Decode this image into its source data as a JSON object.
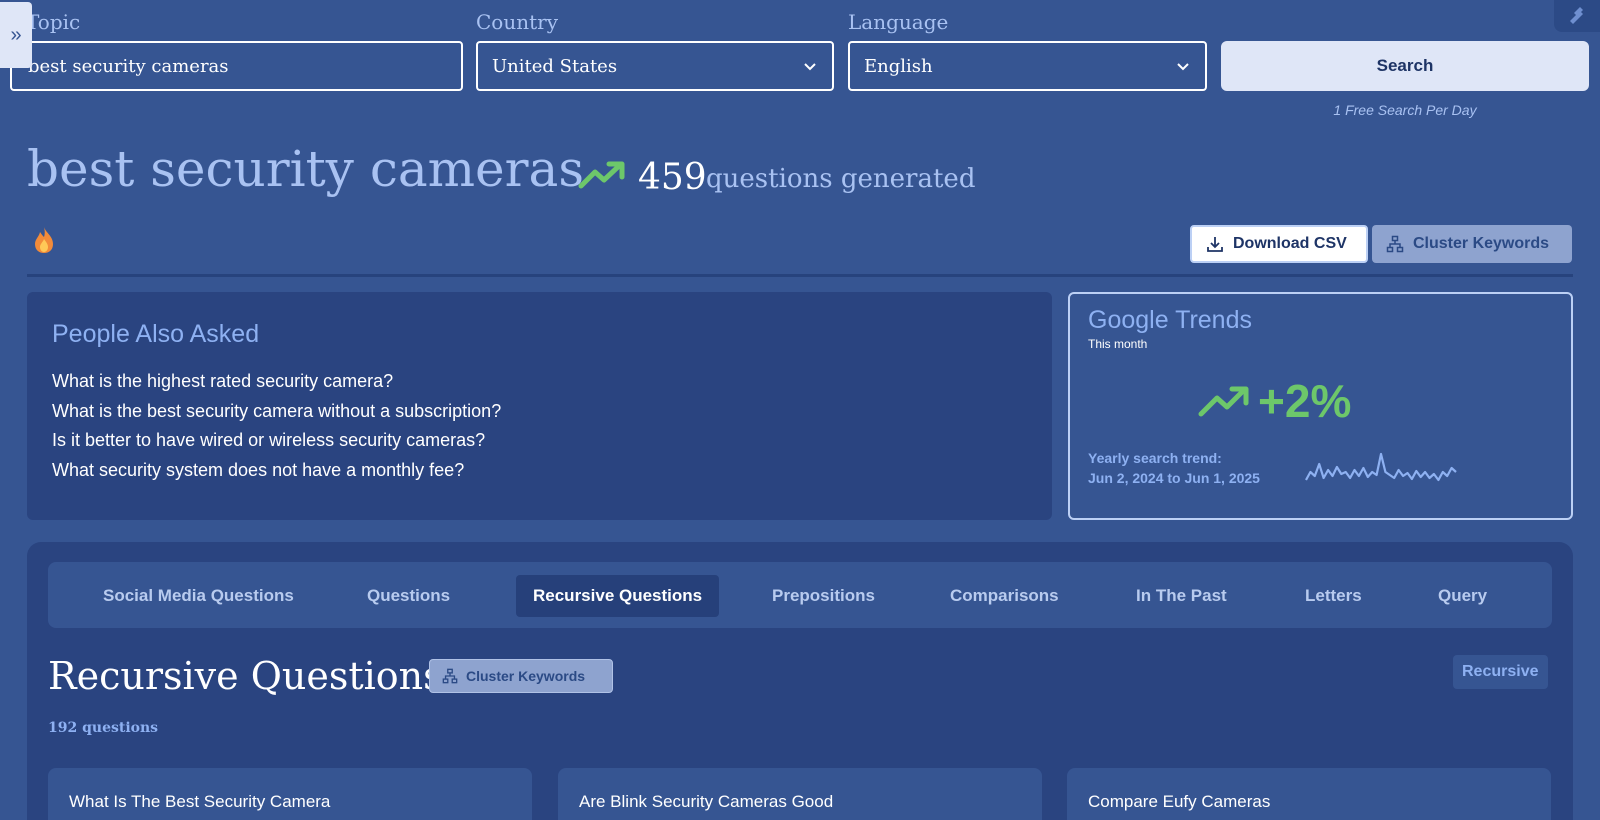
{
  "search_form": {
    "topic_label": "Topic",
    "topic_value": "best security cameras",
    "country_label": "Country",
    "country_value": "United States",
    "language_label": "Language",
    "language_value": "English",
    "search_button": "Search",
    "free_note": "1 Free Search Per Day"
  },
  "header": {
    "title": "best security cameras",
    "question_count": "459",
    "question_label": "questions generated",
    "download_csv": "Download CSV",
    "cluster_keywords": "Cluster Keywords"
  },
  "people_also_asked": {
    "title": "People Also Asked",
    "questions": [
      "What is the highest rated security camera?",
      "What is the best security camera without a subscription?",
      "Is it better to have wired or wireless security cameras?",
      "What security system does not have a monthly fee?"
    ]
  },
  "google_trends": {
    "title": "Google Trends",
    "period": "This month",
    "change": "+2%",
    "yearly_label": "Yearly search trend:",
    "yearly_range": "Jun 2, 2024 to Jun 1, 2025",
    "sparkline": [
      38,
      30,
      34,
      22,
      36,
      28,
      34,
      25,
      32,
      30,
      36,
      28,
      34,
      26,
      35,
      30,
      33,
      12,
      30,
      33,
      36,
      28,
      34,
      31,
      37,
      29,
      35,
      30,
      36,
      32,
      38,
      30,
      34,
      26,
      30
    ]
  },
  "tabs": [
    {
      "label": "Social Media Questions",
      "active": false
    },
    {
      "label": "Questions",
      "active": false
    },
    {
      "label": "Recursive Questions",
      "active": true
    },
    {
      "label": "Prepositions",
      "active": false
    },
    {
      "label": "Comparisons",
      "active": false
    },
    {
      "label": "In The Past",
      "active": false
    },
    {
      "label": "Letters",
      "active": false
    },
    {
      "label": "Query",
      "active": false
    }
  ],
  "section": {
    "title": "Recursive Questions",
    "cluster_keywords": "Cluster Keywords",
    "count": "192 questions",
    "badge": "Recursive"
  },
  "cards": [
    "What Is The Best Security Camera",
    "Are Blink Security Cameras Good",
    "Compare Eufy Cameras"
  ],
  "colors": {
    "background": "#365592",
    "panel": "#2a4480",
    "accent_text": "#a9c2f2",
    "trend_green": "#6dc76a"
  },
  "icons": {
    "sidebar_toggle": "double-chevron-right-icon",
    "trend": "trending-up-icon",
    "fire": "fire-icon",
    "download": "download-icon",
    "cluster": "sitemap-icon",
    "dropdown": "chevron-down-icon"
  }
}
